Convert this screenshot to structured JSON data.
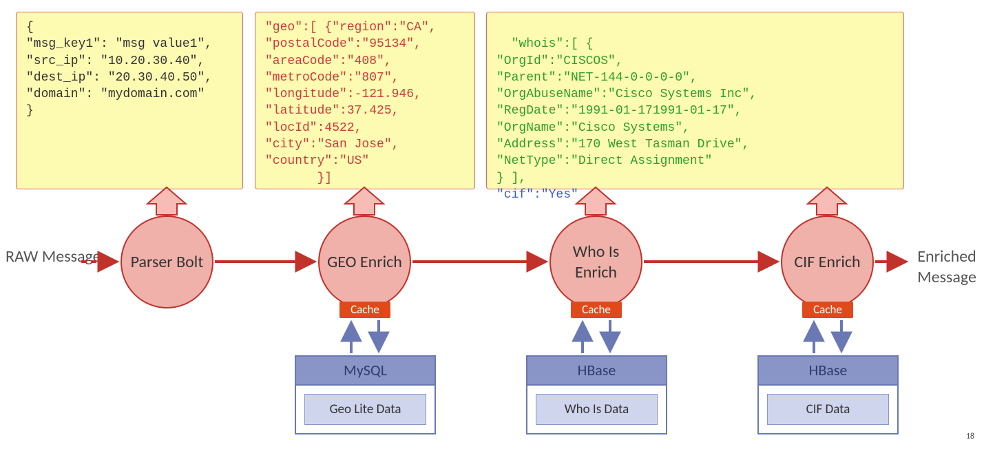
{
  "labels": {
    "raw": "RAW\nMessage",
    "enriched": "Enriched\nMessage"
  },
  "bolts": {
    "parser": "Parser\nBolt",
    "geo": "GEO\nEnrich",
    "whois": "Who\nIs\nEnrich",
    "cif": "CIF\nEnrich"
  },
  "cache_label": "Cache",
  "databases": {
    "geo": {
      "engine": "MySQL",
      "data": "Geo Lite Data"
    },
    "whois": {
      "engine": "HBase",
      "data": "Who Is Data"
    },
    "cif": {
      "engine": "HBase",
      "data": "CIF Data"
    }
  },
  "code": {
    "raw": "{\n\"msg_key1\": \"msg value1\",\n\"src_ip\": \"10.20.30.40\",\n\"dest_ip\": \"20.30.40.50\",\n\"domain\": \"mydomain.com\"\n}",
    "geo": "\"geo\":[ {\"region\":\"CA\",\n\"postalCode\":\"95134\",\n\"areaCode\":\"408\",\n\"metroCode\":\"807\",\n\"longitude\":-121.946,\n\"latitude\":37.425,\n\"locId\":4522,\n\"city\":\"San Jose\",\n\"country\":\"US\"\n       }]",
    "whois": "\"whois\":[ {\n\"OrgId\":\"CISCOS\",\n\"Parent\":\"NET-144-0-0-0-0\",\n\"OrgAbuseName\":\"Cisco Systems Inc\",\n\"RegDate\":\"1991-01-171991-01-17\",\n\"OrgName\":\"Cisco Systems\",\n\"Address\":\"170 West Tasman Drive\",\n\"NetType\":\"Direct Assignment\"\n} ],",
    "cif": "\"cif\":\"Yes\""
  },
  "page_number": "18"
}
